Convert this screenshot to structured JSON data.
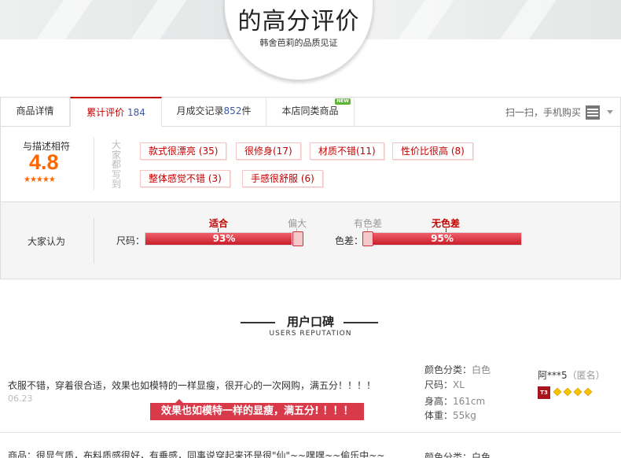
{
  "header": {
    "title": "的高分评价",
    "subtitle": "韩舍芭莉的品质见证"
  },
  "tabs": [
    {
      "label": "商品详情",
      "count": ""
    },
    {
      "label": "累计评价",
      "count": "184"
    },
    {
      "label": "月成交记录",
      "count": "852",
      "suffix": "件"
    },
    {
      "label": "本店同类商品",
      "badge": "NEW"
    }
  ],
  "scan_text": "扫一扫，手机购买",
  "rating": {
    "label": "与描述相符",
    "score": "4.8",
    "stars": "★★★★★",
    "side_label": "大家都写到"
  },
  "tags": [
    "款式很漂亮 (35)",
    "很修身(17)",
    "材质不错(11)",
    "性价比很高 (8)",
    "整体感觉不错 (3)",
    "手感很舒服 (6)"
  ],
  "opinion": {
    "label": "大家认为",
    "size": {
      "name": "尺码：",
      "options": [
        "适合",
        "偏大"
      ],
      "selected": "适合",
      "percent": "93%",
      "value": 0.93
    },
    "color": {
      "name": "色差：",
      "options": [
        "有色差",
        "无色差"
      ],
      "selected": "无色差",
      "percent": "95%",
      "value": 0.95
    }
  },
  "reputation": {
    "title": "用户口碑",
    "subtitle": "USERS REPUTATION"
  },
  "reviews": [
    {
      "text": "衣服不错，穿着很合适，效果也如模特的一样显瘦，很开心的一次网购，满五分！！！！",
      "date": "06.23",
      "quote": "效果也如模特一样的显瘦，满五分! ！！！",
      "color_label": "颜色分类：",
      "color_value": "白色",
      "size_label": "尺码：",
      "size_value": "XL",
      "height_label": "身高：",
      "height_value": "161cm",
      "weight_label": "体重：",
      "weight_value": "55kg",
      "user": "阿***5",
      "anon": "（匿名）",
      "badge": "T3"
    },
    {
      "text": "商品：很显气质，布料质感很好，有垂感，同事说穿起来还是很\"仙\"~~嘿嘿~~偷乐中~~",
      "color_label": "颜色分类：白色"
    }
  ]
}
